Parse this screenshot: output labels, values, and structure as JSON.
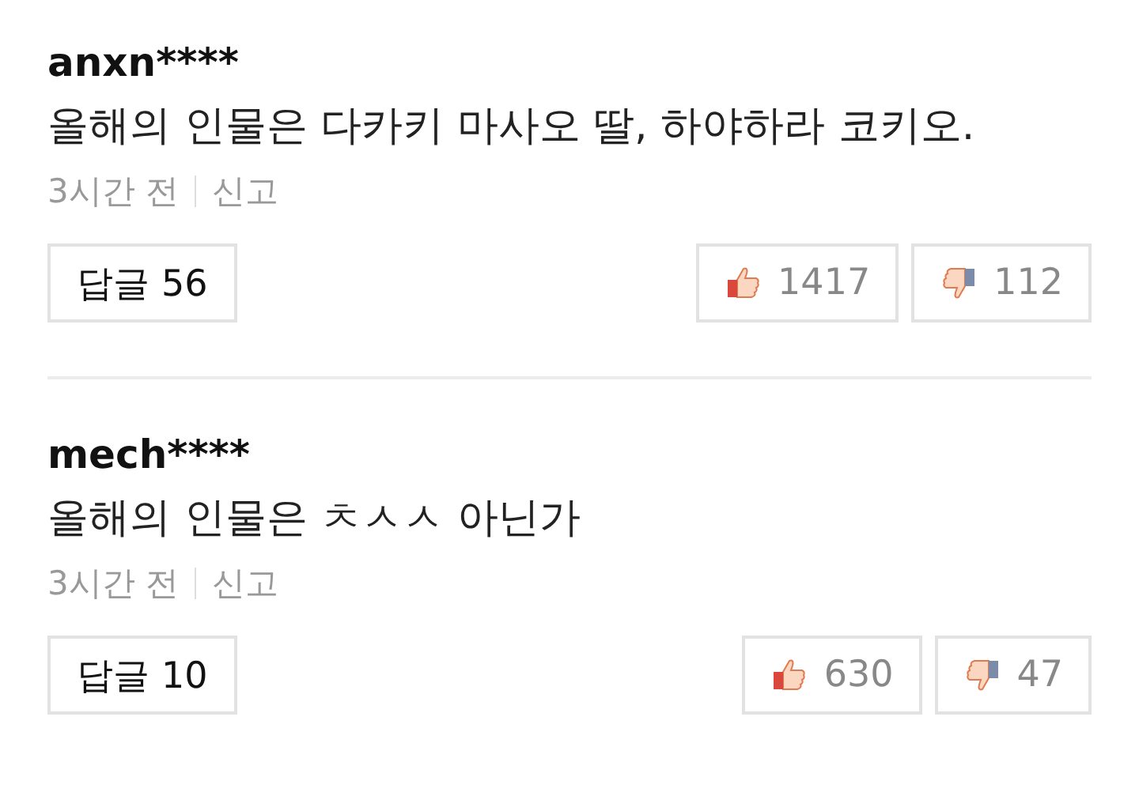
{
  "comments": [
    {
      "author": "anxn****",
      "text": "올해의 인물은 다카키 마사오 딸, 하야하라 코키오.",
      "time": "3시간 전",
      "report": "신고",
      "reply": "답글 56",
      "likes": "1417",
      "dislikes": "112"
    },
    {
      "author": "mech****",
      "text": "올해의 인물은 ㅊㅅㅅ 아닌가",
      "time": "3시간 전",
      "report": "신고",
      "reply": "답글 10",
      "likes": "630",
      "dislikes": "47"
    }
  ]
}
